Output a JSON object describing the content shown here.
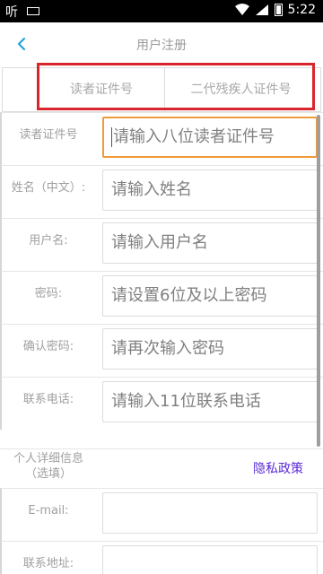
{
  "status_bar": {
    "left_text": "听",
    "time": "5:22"
  },
  "header": {
    "title": "用户注册"
  },
  "tabs": [
    {
      "label": "读者证件号"
    },
    {
      "label": "二代残疾人证件号"
    }
  ],
  "form": {
    "fields": [
      {
        "label": "读者证件号",
        "placeholder": "请输入八位读者证件号"
      },
      {
        "label": "姓名（中文）:",
        "placeholder": "请输入姓名"
      },
      {
        "label": "用户名:",
        "placeholder": "请输入用户名"
      },
      {
        "label": "密码:",
        "placeholder": "请设置6位及以上密码"
      },
      {
        "label": "确认密码:",
        "placeholder": "请再次输入密码"
      },
      {
        "label": "联系电话:",
        "placeholder": "请输入11位联系电话"
      }
    ],
    "details_section": {
      "title": "个人详细信息（选填）",
      "privacy_link": "隐私政策"
    },
    "optional_fields": [
      {
        "label": "E-mail:",
        "placeholder": ""
      },
      {
        "label": "联系地址:",
        "placeholder": ""
      }
    ]
  },
  "colors": {
    "accent_border": "#ef9a3b",
    "highlight_box": "#d9252c",
    "back_arrow": "#2aa1d8",
    "privacy_link": "#5a2bd8"
  }
}
